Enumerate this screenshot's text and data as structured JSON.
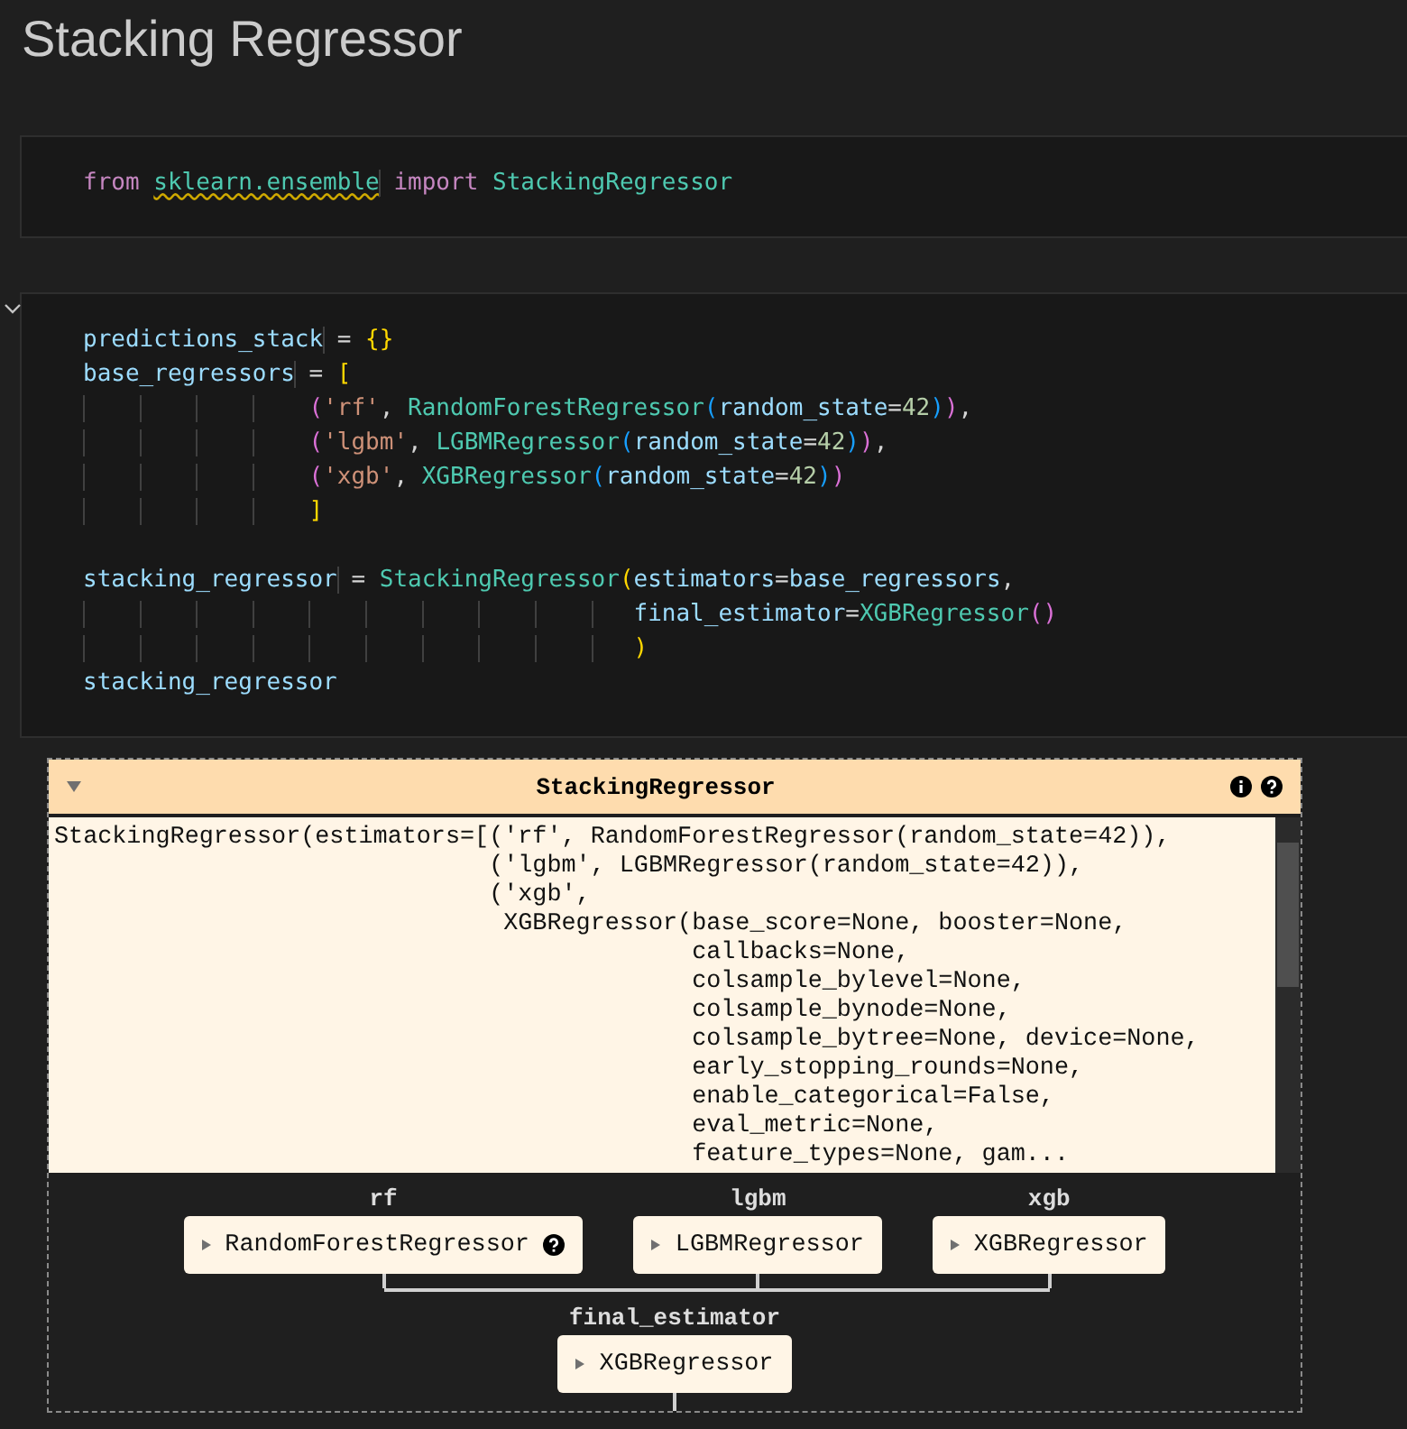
{
  "title": "Stacking Regressor",
  "cells": [
    {
      "collapsible": false,
      "groups": [
        [
          [
            {
              "t": "from ",
              "kind": "kw"
            },
            {
              "t": "sklearn.ensemble",
              "kind": "mod",
              "squiggle": true
            },
            {
              "t": " import ",
              "kind": "kw"
            },
            {
              "t": "StackingRegressor",
              "kind": "cls"
            }
          ]
        ]
      ]
    },
    {
      "collapsible": true,
      "groups": [
        [
          [
            {
              "t": "predictions_stack",
              "kind": "var"
            },
            {
              "t": " = ",
              "kind": "op"
            },
            {
              "t": "{}",
              "kind": "b1"
            }
          ],
          [
            {
              "t": "base_regressors",
              "kind": "var"
            },
            {
              "t": " = ",
              "kind": "op"
            },
            {
              "t": "[",
              "kind": "b1"
            }
          ],
          [
            {
              "t": "                (",
              "kind": "b2"
            },
            {
              "t": "'rf'",
              "kind": "str"
            },
            {
              "t": ", ",
              "kind": "op"
            },
            {
              "t": "RandomForestRegressor",
              "kind": "cls"
            },
            {
              "t": "(",
              "kind": "b3"
            },
            {
              "t": "random_state",
              "kind": "var"
            },
            {
              "t": "=",
              "kind": "op"
            },
            {
              "t": "42",
              "kind": "num"
            },
            {
              "t": ")",
              "kind": "b3"
            },
            {
              "t": ")",
              "kind": "b2"
            },
            {
              "t": ",",
              "kind": "op"
            }
          ],
          [
            {
              "t": "                (",
              "kind": "b2"
            },
            {
              "t": "'lgbm'",
              "kind": "str"
            },
            {
              "t": ", ",
              "kind": "op"
            },
            {
              "t": "LGBMRegressor",
              "kind": "cls"
            },
            {
              "t": "(",
              "kind": "b3"
            },
            {
              "t": "random_state",
              "kind": "var"
            },
            {
              "t": "=",
              "kind": "op"
            },
            {
              "t": "42",
              "kind": "num"
            },
            {
              "t": ")",
              "kind": "b3"
            },
            {
              "t": ")",
              "kind": "b2"
            },
            {
              "t": ",",
              "kind": "op"
            }
          ],
          [
            {
              "t": "                (",
              "kind": "b2"
            },
            {
              "t": "'xgb'",
              "kind": "str"
            },
            {
              "t": ", ",
              "kind": "op"
            },
            {
              "t": "XGBRegressor",
              "kind": "cls"
            },
            {
              "t": "(",
              "kind": "b3"
            },
            {
              "t": "random_state",
              "kind": "var"
            },
            {
              "t": "=",
              "kind": "op"
            },
            {
              "t": "42",
              "kind": "num"
            },
            {
              "t": ")",
              "kind": "b3"
            },
            {
              "t": ")",
              "kind": "b2"
            }
          ],
          [
            {
              "t": "                ]",
              "kind": "b1"
            }
          ]
        ],
        [
          [
            {
              "t": "stacking_regressor",
              "kind": "var"
            },
            {
              "t": " = ",
              "kind": "op"
            },
            {
              "t": "StackingRegressor",
              "kind": "cls"
            },
            {
              "t": "(",
              "kind": "b1"
            },
            {
              "t": "estimators",
              "kind": "var"
            },
            {
              "t": "=",
              "kind": "op"
            },
            {
              "t": "base_regressors",
              "kind": "var"
            },
            {
              "t": ",",
              "kind": "op"
            }
          ],
          [
            {
              "t": "                                       final_estimator",
              "kind": "var"
            },
            {
              "t": "=",
              "kind": "op"
            },
            {
              "t": "XGBRegressor",
              "kind": "cls"
            },
            {
              "t": "()",
              "kind": "b2"
            }
          ],
          [
            {
              "t": "                                       )",
              "kind": "b1"
            }
          ],
          [
            {
              "t": "stacking_regressor",
              "kind": "var"
            }
          ]
        ]
      ]
    }
  ],
  "output": {
    "title": "StackingRegressor",
    "expanded": true,
    "repr_lines": [
      "StackingRegressor(estimators=[('rf', RandomForestRegressor(random_state=42)),",
      "                              ('lgbm', LGBMRegressor(random_state=42)),",
      "                              ('xgb',",
      "                               XGBRegressor(base_score=None, booster=None,",
      "                                            callbacks=None,",
      "                                            colsample_bylevel=None,",
      "                                            colsample_bynode=None,",
      "                                            colsample_bytree=None, device=None,",
      "                                            early_stopping_rounds=None,",
      "                                            enable_categorical=False,",
      "                                            eval_metric=None,",
      "                                            feature_types=None, gam..."
    ],
    "estimators": [
      {
        "label": "rf",
        "name": "RandomForestRegressor",
        "help": true
      },
      {
        "label": "lgbm",
        "name": "LGBMRegressor",
        "help": false
      },
      {
        "label": "xgb",
        "name": "XGBRegressor",
        "help": false
      }
    ],
    "final": {
      "label": "final_estimator",
      "name": "XGBRegressor",
      "help": false
    }
  }
}
